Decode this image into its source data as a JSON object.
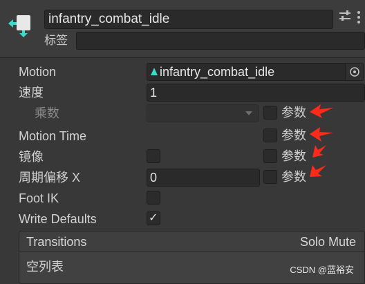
{
  "header": {
    "state_name": "infantry_combat_idle",
    "tag_label": "标签",
    "tag_value": ""
  },
  "rows": {
    "motion_label": "Motion",
    "motion_value": "infantry_combat_idle",
    "speed_label": "速度",
    "speed_value": "1",
    "multiplier_label": "乘数",
    "multiplier_value": "",
    "motion_time_label": "Motion Time",
    "mirror_label": "镜像",
    "cycle_offset_label": "周期偏移 X",
    "cycle_offset_value": "0",
    "foot_ik_label": "Foot IK",
    "write_defaults_label": "Write Defaults",
    "write_defaults_checked": true,
    "mirror_checked": false,
    "foot_ik_checked": false
  },
  "param_label": "参数",
  "param_checkboxes": {
    "multiplier": false,
    "motion_time": false,
    "mirror": false,
    "cycle_offset": false
  },
  "transitions": {
    "title": "Transitions",
    "columns": "Solo Mute",
    "empty_text": "空列表"
  },
  "watermark": "CSDN @蓝裕安",
  "colors": {
    "background": "#383838",
    "field": "#2a2a2a",
    "text": "#d2d2d2",
    "annotation_arrow": "#ff2a1a",
    "state_icon": "#3fd9c8"
  },
  "icons": [
    "animator-state-icon",
    "settings-icon",
    "more-options-icon",
    "animation-clip-icon",
    "object-picker-icon",
    "dropdown-arrow-icon",
    "checkmark-icon",
    "red-arrow-annotation"
  ]
}
